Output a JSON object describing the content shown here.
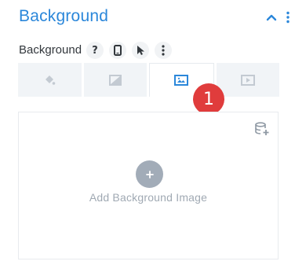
{
  "section": {
    "title": "Background",
    "collapse_icon": "chevron-up-icon",
    "menu_icon": "kebab-menu-icon"
  },
  "field": {
    "label": "Background",
    "controls": [
      {
        "icon": "help-icon",
        "text": "?"
      },
      {
        "icon": "mobile-device-icon"
      },
      {
        "icon": "cursor-hover-icon"
      },
      {
        "icon": "kebab-menu-icon"
      }
    ]
  },
  "tabs": [
    {
      "icon": "paint-bucket-icon",
      "active": false
    },
    {
      "icon": "gradient-icon",
      "active": false
    },
    {
      "icon": "image-icon",
      "active": true
    },
    {
      "icon": "video-icon",
      "active": false
    }
  ],
  "badge": {
    "text": "1",
    "color": "#e03c3c"
  },
  "dropzone": {
    "library_icon": "stack-add-icon",
    "add_icon": "plus-icon",
    "add_text": "Add Background Image"
  },
  "colors": {
    "accent": "#2b87da",
    "tab_bg": "#f1f4f7",
    "add_circle": "#a2acb8"
  }
}
